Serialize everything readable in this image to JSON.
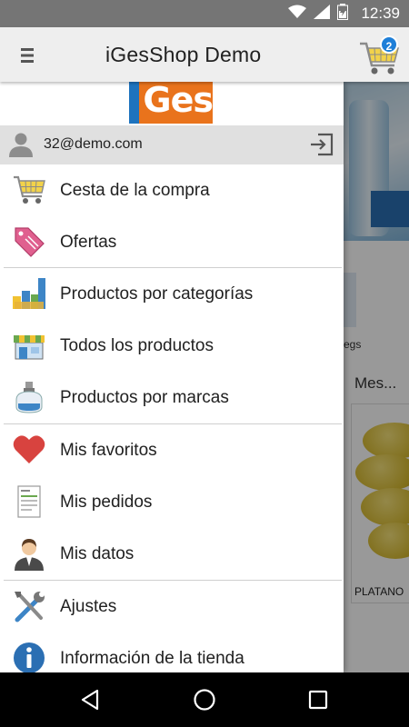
{
  "status_bar": {
    "time": "12:39"
  },
  "app_bar": {
    "title": "iGesShop Demo",
    "cart_count": "2"
  },
  "drawer": {
    "logo_text": "Ges",
    "user_email": "32@demo.com",
    "items": [
      {
        "label": "Cesta de la compra",
        "icon": "cart-icon"
      },
      {
        "label": "Ofertas",
        "icon": "offer-tag-icon"
      },
      {
        "label": "Productos por categorías",
        "icon": "categories-icon"
      },
      {
        "label": "Todos los productos",
        "icon": "store-icon"
      },
      {
        "label": "Productos por marcas",
        "icon": "perfume-bottle-icon"
      },
      {
        "label": "Mis favoritos",
        "icon": "heart-icon"
      },
      {
        "label": "Mis pedidos",
        "icon": "order-document-icon"
      },
      {
        "label": "Mis datos",
        "icon": "user-profile-icon"
      },
      {
        "label": "Ajustes",
        "icon": "tools-icon"
      },
      {
        "label": "Información de la tienda",
        "icon": "info-icon"
      }
    ]
  },
  "background": {
    "partial_label": "egs",
    "section_title": "Mes...",
    "product_name": "PLATANO"
  },
  "colors": {
    "app_bar": "#eeeeee",
    "status_bar": "#757575",
    "badge": "#1e7fd8",
    "logo_orange": "#e9731c",
    "logo_blue": "#1e73be"
  }
}
